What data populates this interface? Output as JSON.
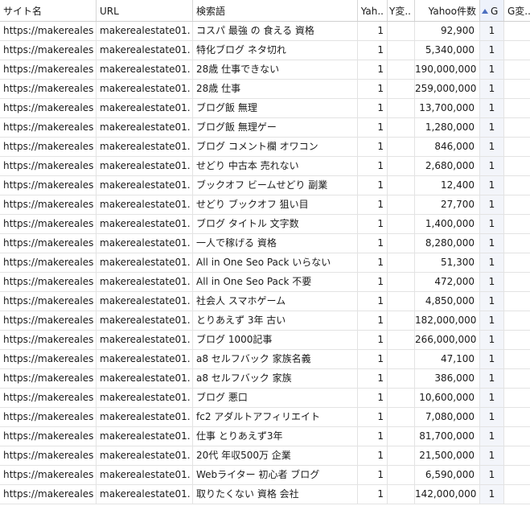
{
  "columns": {
    "site": "サイト名",
    "url": "URL",
    "keyword": "検索語",
    "yahoo_rank": "Yah..",
    "yahoo_change": "Y変..",
    "yahoo_count": "Yahoo件数",
    "google_rank": "G",
    "google_change": "G変..."
  },
  "colors": {
    "sorted_header": "#eef2fb",
    "sort_arrow": "#4c6fc0",
    "g_column": "#f3f5fa"
  },
  "rows": [
    {
      "site": "https://makereales",
      "url": "makerealestate01.",
      "keyword": "コスパ 最強 の 食える 資格",
      "yahoo_rank": "1",
      "yahoo_change": "",
      "yahoo_count": "92,900",
      "google_rank": "1",
      "google_change": ""
    },
    {
      "site": "https://makereales",
      "url": "makerealestate01.",
      "keyword": "特化ブログ ネタ切れ",
      "yahoo_rank": "1",
      "yahoo_change": "",
      "yahoo_count": "5,340,000",
      "google_rank": "1",
      "google_change": ""
    },
    {
      "site": "https://makereales",
      "url": "makerealestate01.",
      "keyword": "28歳 仕事できない",
      "yahoo_rank": "1",
      "yahoo_change": "",
      "yahoo_count": "190,000,000",
      "google_rank": "1",
      "google_change": ""
    },
    {
      "site": "https://makereales",
      "url": "makerealestate01.",
      "keyword": "28歳 仕事",
      "yahoo_rank": "1",
      "yahoo_change": "",
      "yahoo_count": "259,000,000",
      "google_rank": "1",
      "google_change": ""
    },
    {
      "site": "https://makereales",
      "url": "makerealestate01.",
      "keyword": "ブログ飯 無理",
      "yahoo_rank": "1",
      "yahoo_change": "",
      "yahoo_count": "13,700,000",
      "google_rank": "1",
      "google_change": ""
    },
    {
      "site": "https://makereales",
      "url": "makerealestate01.",
      "keyword": "ブログ飯 無理ゲー",
      "yahoo_rank": "1",
      "yahoo_change": "",
      "yahoo_count": "1,280,000",
      "google_rank": "1",
      "google_change": ""
    },
    {
      "site": "https://makereales",
      "url": "makerealestate01.",
      "keyword": "ブログ コメント欄 オワコン",
      "yahoo_rank": "1",
      "yahoo_change": "",
      "yahoo_count": "846,000",
      "google_rank": "1",
      "google_change": ""
    },
    {
      "site": "https://makereales",
      "url": "makerealestate01.",
      "keyword": "せどり 中古本 売れない",
      "yahoo_rank": "1",
      "yahoo_change": "",
      "yahoo_count": "2,680,000",
      "google_rank": "1",
      "google_change": ""
    },
    {
      "site": "https://makereales",
      "url": "makerealestate01.",
      "keyword": "ブックオフ ビームせどり 副業",
      "yahoo_rank": "1",
      "yahoo_change": "",
      "yahoo_count": "12,400",
      "google_rank": "1",
      "google_change": ""
    },
    {
      "site": "https://makereales",
      "url": "makerealestate01.",
      "keyword": "せどり ブックオフ 狙い目",
      "yahoo_rank": "1",
      "yahoo_change": "",
      "yahoo_count": "27,700",
      "google_rank": "1",
      "google_change": ""
    },
    {
      "site": "https://makereales",
      "url": "makerealestate01.",
      "keyword": "ブログ タイトル 文字数",
      "yahoo_rank": "1",
      "yahoo_change": "",
      "yahoo_count": "1,400,000",
      "google_rank": "1",
      "google_change": ""
    },
    {
      "site": "https://makereales",
      "url": "makerealestate01.",
      "keyword": "一人で稼げる 資格",
      "yahoo_rank": "1",
      "yahoo_change": "",
      "yahoo_count": "8,280,000",
      "google_rank": "1",
      "google_change": ""
    },
    {
      "site": "https://makereales",
      "url": "makerealestate01.",
      "keyword": "All in One Seo Pack いらない",
      "yahoo_rank": "1",
      "yahoo_change": "",
      "yahoo_count": "51,300",
      "google_rank": "1",
      "google_change": ""
    },
    {
      "site": "https://makereales",
      "url": "makerealestate01.",
      "keyword": "All in One Seo Pack 不要",
      "yahoo_rank": "1",
      "yahoo_change": "",
      "yahoo_count": "472,000",
      "google_rank": "1",
      "google_change": ""
    },
    {
      "site": "https://makereales",
      "url": "makerealestate01.",
      "keyword": "社会人 スマホゲーム",
      "yahoo_rank": "1",
      "yahoo_change": "",
      "yahoo_count": "4,850,000",
      "google_rank": "1",
      "google_change": ""
    },
    {
      "site": "https://makereales",
      "url": "makerealestate01.",
      "keyword": "とりあえず 3年 古い",
      "yahoo_rank": "1",
      "yahoo_change": "",
      "yahoo_count": "182,000,000",
      "google_rank": "1",
      "google_change": ""
    },
    {
      "site": "https://makereales",
      "url": "makerealestate01.",
      "keyword": "ブログ 1000記事",
      "yahoo_rank": "1",
      "yahoo_change": "",
      "yahoo_count": "266,000,000",
      "google_rank": "1",
      "google_change": ""
    },
    {
      "site": "https://makereales",
      "url": "makerealestate01.",
      "keyword": "a8 セルフバック 家族名義",
      "yahoo_rank": "1",
      "yahoo_change": "",
      "yahoo_count": "47,100",
      "google_rank": "1",
      "google_change": ""
    },
    {
      "site": "https://makereales",
      "url": "makerealestate01.",
      "keyword": "a8 セルフバック 家族",
      "yahoo_rank": "1",
      "yahoo_change": "",
      "yahoo_count": "386,000",
      "google_rank": "1",
      "google_change": ""
    },
    {
      "site": "https://makereales",
      "url": "makerealestate01.",
      "keyword": "ブログ 悪口",
      "yahoo_rank": "1",
      "yahoo_change": "",
      "yahoo_count": "10,600,000",
      "google_rank": "1",
      "google_change": ""
    },
    {
      "site": "https://makereales",
      "url": "makerealestate01.",
      "keyword": "fc2 アダルトアフィリエイト",
      "yahoo_rank": "1",
      "yahoo_change": "",
      "yahoo_count": "7,080,000",
      "google_rank": "1",
      "google_change": ""
    },
    {
      "site": "https://makereales",
      "url": "makerealestate01.",
      "keyword": "仕事 とりあえず3年",
      "yahoo_rank": "1",
      "yahoo_change": "",
      "yahoo_count": "81,700,000",
      "google_rank": "1",
      "google_change": ""
    },
    {
      "site": "https://makereales",
      "url": "makerealestate01.",
      "keyword": "20代 年収500万 企業",
      "yahoo_rank": "1",
      "yahoo_change": "",
      "yahoo_count": "21,500,000",
      "google_rank": "1",
      "google_change": ""
    },
    {
      "site": "https://makereales",
      "url": "makerealestate01.",
      "keyword": "Webライター 初心者 ブログ",
      "yahoo_rank": "1",
      "yahoo_change": "",
      "yahoo_count": "6,590,000",
      "google_rank": "1",
      "google_change": ""
    },
    {
      "site": "https://makereales",
      "url": "makerealestate01.",
      "keyword": "取りたくない 資格 会社",
      "yahoo_rank": "1",
      "yahoo_change": "",
      "yahoo_count": "142,000,000",
      "google_rank": "1",
      "google_change": ""
    }
  ]
}
